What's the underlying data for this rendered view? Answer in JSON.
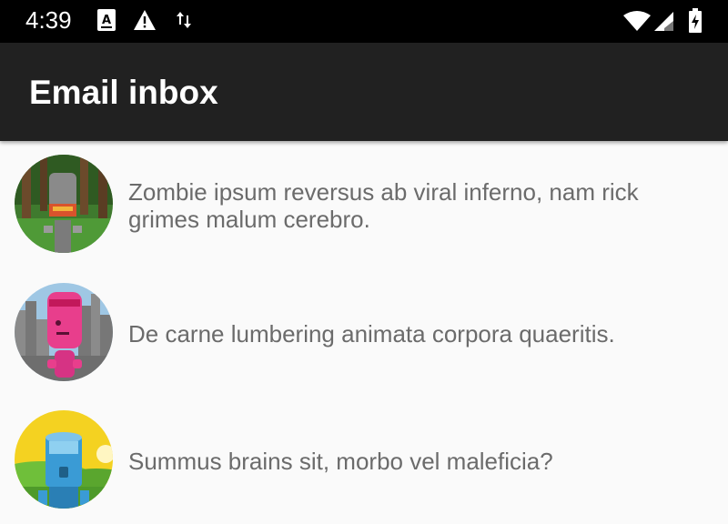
{
  "status_bar": {
    "time": "4:39",
    "icons": [
      "a-keyboard-icon",
      "warning-icon",
      "data-transfer-icon",
      "wifi-icon",
      "signal-icon",
      "battery-charging-icon"
    ]
  },
  "app_bar": {
    "title": "Email inbox",
    "background": "#212121"
  },
  "emails": [
    {
      "avatar": "robot-forest-avatar",
      "text": "Zombie ipsum reversus ab viral inferno, nam rick grimes malum cerebro."
    },
    {
      "avatar": "robot-city-avatar",
      "text": "De carne lumbering animata corpora quaeritis."
    },
    {
      "avatar": "robot-meadow-avatar",
      "text": "Summus brains sit, morbo vel maleficia?"
    }
  ]
}
